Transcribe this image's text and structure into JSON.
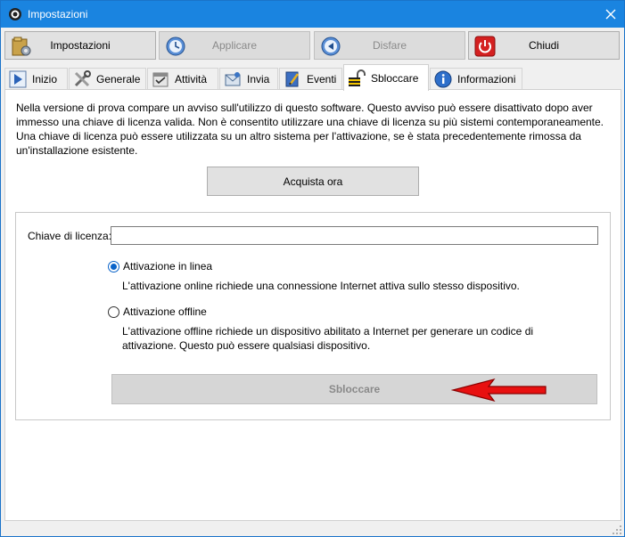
{
  "window": {
    "title": "Impostazioni",
    "accent": "#1a84e0"
  },
  "toolbar": {
    "impostazioni": "Impostazioni",
    "applicare": "Applicare",
    "disfare": "Disfare",
    "chiudi": "Chiudi"
  },
  "tabs": [
    {
      "label": "Inizio",
      "icon": "play-icon"
    },
    {
      "label": "Generale",
      "icon": "tools-icon"
    },
    {
      "label": "Attività",
      "icon": "tasks-icon"
    },
    {
      "label": "Invia",
      "icon": "mail-icon"
    },
    {
      "label": "Eventi",
      "icon": "notebook-icon"
    },
    {
      "label": "Sbloccare",
      "icon": "padlock-icon"
    },
    {
      "label": "Informazioni",
      "icon": "info-icon"
    }
  ],
  "active_tab": "Sbloccare",
  "panel": {
    "intro": "Nella versione di prova compare un avviso sull'utilizzo di questo software. Questo avviso può essere disattivato dopo aver immesso una chiave di licenza valida. Non è consentito utilizzare una chiave di licenza su più sistemi contemporaneamente. Una chiave di licenza può essere utilizzata su un altro sistema per l'attivazione, se è stata precedentemente rimossa da un'installazione esistente.",
    "buy_button": "Acquista ora",
    "license_label": "Chiave di licenza:",
    "license_value": "",
    "online_label": "Attivazione in linea",
    "online_desc": "L'attivazione online richiede una connessione Internet attiva sullo stesso dispositivo.",
    "offline_label": "Attivazione offline",
    "offline_desc": "L'attivazione offline richiede un dispositivo abilitato a Internet per generare un codice di attivazione. Questo può essere qualsiasi dispositivo.",
    "selected_activation": "online",
    "unlock_button": "Sbloccare"
  },
  "annotation": {
    "arrow_color": "#e81010"
  }
}
